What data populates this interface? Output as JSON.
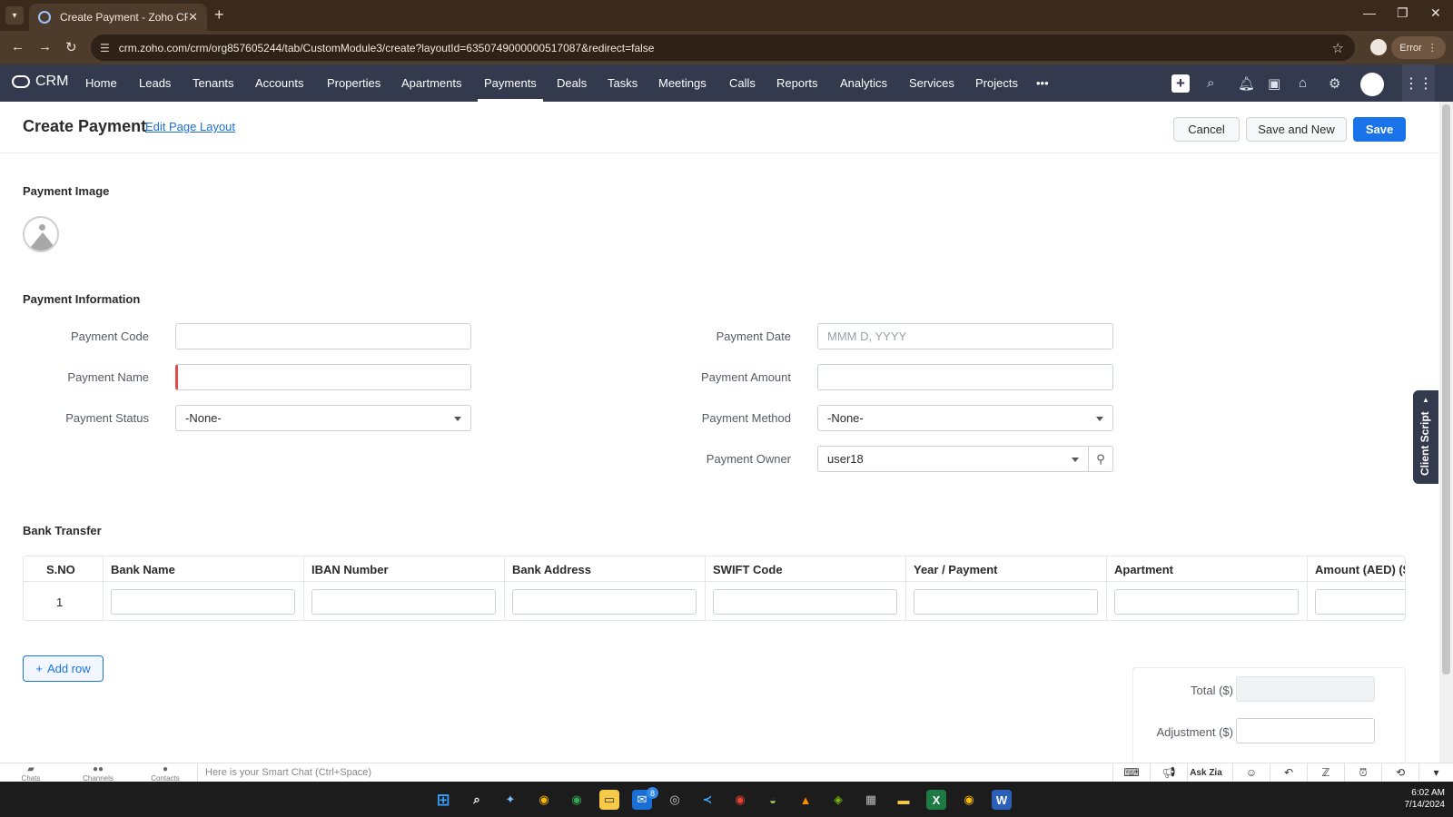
{
  "browser": {
    "tab_title": "Create Payment - Zoho CRM",
    "url": "crm.zoho.com/crm/org857605244/tab/CustomModule3/create?layoutId=6350749000000517087&redirect=false",
    "error_label": "Error"
  },
  "crm_nav": {
    "brand": "CRM",
    "items": [
      "Home",
      "Leads",
      "Tenants",
      "Accounts",
      "Properties",
      "Apartments",
      "Payments",
      "Deals",
      "Tasks",
      "Meetings",
      "Calls",
      "Reports",
      "Analytics",
      "Services",
      "Projects"
    ],
    "active": "Payments",
    "more": "•••"
  },
  "header": {
    "title": "Create Payment",
    "edit_layout": "Edit Page Layout",
    "cancel": "Cancel",
    "save_and_new": "Save and New",
    "save": "Save"
  },
  "sections": {
    "image": "Payment Image",
    "info": "Payment Information",
    "bank": "Bank Transfer"
  },
  "fields": {
    "payment_code": {
      "label": "Payment Code",
      "value": ""
    },
    "payment_name": {
      "label": "Payment Name",
      "value": ""
    },
    "payment_status": {
      "label": "Payment Status",
      "value": "-None-"
    },
    "payment_date": {
      "label": "Payment Date",
      "placeholder": "MMM D, YYYY"
    },
    "payment_amount": {
      "label": "Payment Amount",
      "value": ""
    },
    "payment_method": {
      "label": "Payment Method",
      "value": "-None-"
    },
    "payment_owner": {
      "label": "Payment Owner",
      "value": "user18"
    }
  },
  "bank_table": {
    "columns": [
      "S.NO",
      "Bank Name",
      "IBAN Number",
      "Bank Address",
      "SWIFT Code",
      "Year / Payment",
      "Apartment",
      "Amount (AED) ($)"
    ],
    "rows": [
      [
        "1",
        "",
        "",
        "",
        "",
        "",
        "",
        ""
      ]
    ],
    "add_row": "Add row"
  },
  "totals": {
    "total_label": "Total ($)",
    "adjustment_label": "Adjustment ($)"
  },
  "client_script": "Client Script",
  "chatbar": {
    "chats": "Chats",
    "channels": "Channels",
    "contacts": "Contacts",
    "smart_chat": "Here is your Smart Chat (Ctrl+Space)",
    "ask_zia": "Ask Zia"
  },
  "taskbar": {
    "time": "6:02 AM",
    "date": "7/14/2024",
    "mail_badge": "8"
  },
  "colors": {
    "nav_bg": "#333a4e",
    "primary": "#1a73e8",
    "required": "#e24c4c",
    "browser_bg": "#3a2a1c"
  }
}
